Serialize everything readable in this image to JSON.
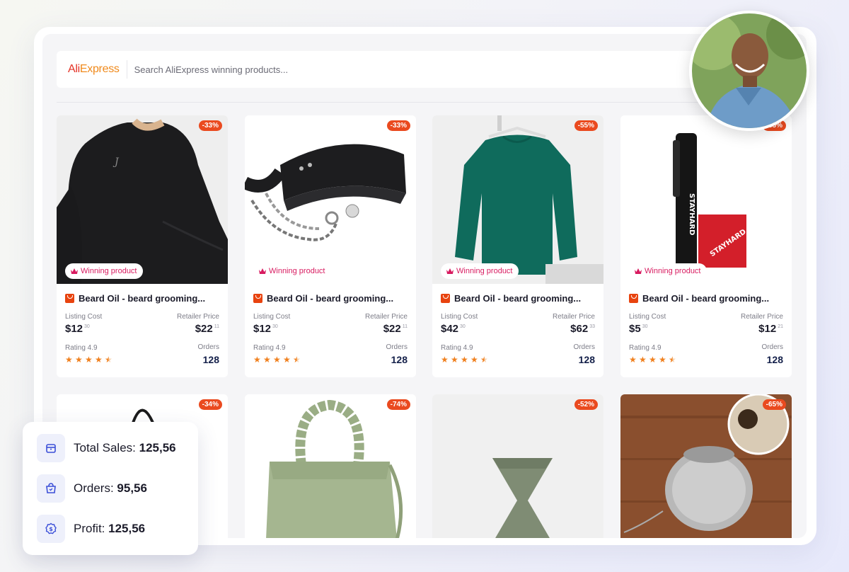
{
  "search": {
    "logo_ali": "Ali",
    "logo_express": "Express",
    "placeholder": "Search AliExpress winning products..."
  },
  "labels": {
    "winning": "Winning product",
    "listing_cost": "Listing Cost",
    "retailer_price": "Retailer Price",
    "orders": "Orders"
  },
  "products": [
    {
      "discount": "-33%",
      "title": "Beard Oil - beard grooming...",
      "cost": "$12",
      "cost_cents": "30",
      "price": "$22",
      "price_cents": "11",
      "rating": "Rating 4.9",
      "orders": "128"
    },
    {
      "discount": "-33%",
      "title": "Beard Oil - beard grooming...",
      "cost": "$12",
      "cost_cents": "30",
      "price": "$22",
      "price_cents": "11",
      "rating": "Rating 4.9",
      "orders": "128"
    },
    {
      "discount": "-55%",
      "title": "Beard Oil - beard grooming...",
      "cost": "$42",
      "cost_cents": "30",
      "price": "$62",
      "price_cents": "33",
      "rating": "Rating 4.9",
      "orders": "128"
    },
    {
      "discount": "-55%",
      "title": "Beard Oil - beard grooming...",
      "cost": "$5",
      "cost_cents": "30",
      "price": "$12",
      "price_cents": "21",
      "rating": "Rating 4.9",
      "orders": "128"
    },
    {
      "discount": "-34%"
    },
    {
      "discount": "-74%"
    },
    {
      "discount": "-52%"
    },
    {
      "discount": "-65%"
    }
  ],
  "stats": {
    "total_sales_label": "Total Sales:",
    "total_sales_value": "125,56",
    "orders_label": "Orders:",
    "orders_value": "95,56",
    "profit_label": "Profit:",
    "profit_value": "125,56"
  },
  "colors": {
    "accent_red": "#ea4a1f",
    "winning_pink": "#d81b60",
    "star_orange": "#f0801e"
  }
}
